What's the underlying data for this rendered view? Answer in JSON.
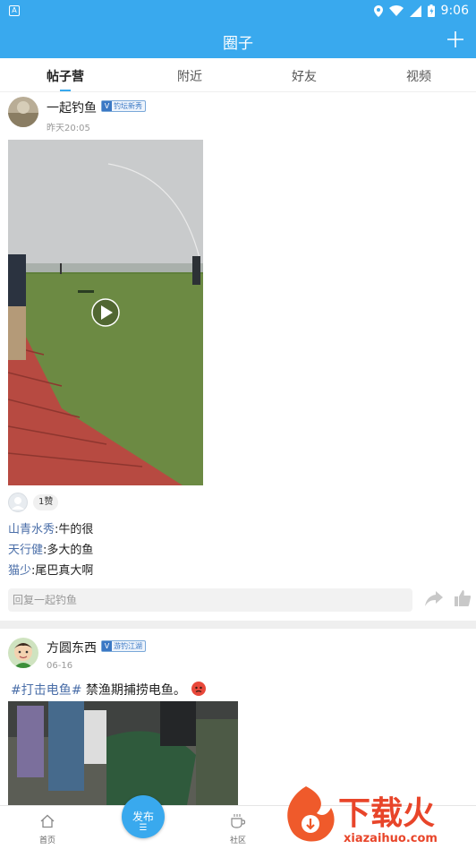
{
  "status_bar": {
    "time": "9:06"
  },
  "header": {
    "title": "圈子"
  },
  "tabs": [
    {
      "label": "帖子营"
    },
    {
      "label": "附近"
    },
    {
      "label": "好友"
    },
    {
      "label": "视频"
    }
  ],
  "posts": [
    {
      "username": "一起钓鱼",
      "badge": "钓坛新秀",
      "time": "昨天20:05",
      "likes": "1赞",
      "comments": [
        {
          "name": "山青水秀",
          "text": ":牛的很"
        },
        {
          "name": "天行健",
          "text": ":多大的鱼"
        },
        {
          "name": "猫少",
          "text": ":尾巴真大啊"
        }
      ],
      "reply_placeholder": "回复一起钓鱼"
    },
    {
      "username": "方圆东西",
      "badge": "游钓江湖",
      "time": "06-16",
      "tag": "#打击电鱼#",
      "text": " 禁渔期捕捞电鱼。"
    }
  ],
  "bottom_nav": {
    "home": "首页",
    "publish": "发布",
    "community": "社区"
  },
  "watermark": {
    "brand": "下载火",
    "url": "xiazaihuo.com"
  }
}
